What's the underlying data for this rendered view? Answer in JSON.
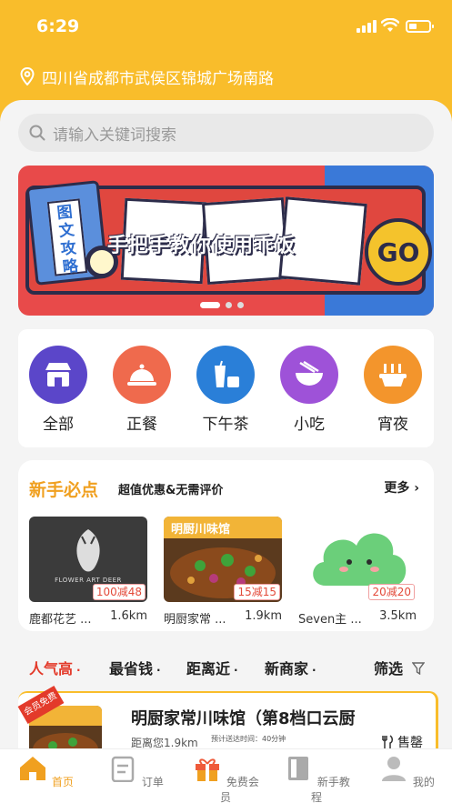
{
  "status": {
    "time": "6:29"
  },
  "location": {
    "address": "四川省成都市武侯区锦城广场南路"
  },
  "search": {
    "placeholder": "请输入关键词搜索"
  },
  "banner": {
    "book_title": "图文攻略",
    "slogan": "手把手教你使用乖饭",
    "go": "GO"
  },
  "categories": [
    {
      "label": "全部",
      "color": "#5b46c9"
    },
    {
      "label": "正餐",
      "color": "#ef6a4d"
    },
    {
      "label": "下午茶",
      "color": "#2a7fd8"
    },
    {
      "label": "小吃",
      "color": "#9e52d8"
    },
    {
      "label": "宵夜",
      "color": "#f3952c"
    }
  ],
  "newbie": {
    "title": "新手必点",
    "subtitle": "超值优惠&无需评价",
    "more": "更多",
    "shops": [
      {
        "name": "鹿都花艺 ...",
        "distance": "1.6km",
        "coupon": "100减48",
        "image_caption": "FLOWER ART DEER"
      },
      {
        "name": "明厨家常 ...",
        "distance": "1.9km",
        "coupon": "15减15",
        "image_caption": "明厨川味馆"
      },
      {
        "name": "Seven主 ...",
        "distance": "3.5km",
        "coupon": "20减20",
        "image_caption": ""
      }
    ]
  },
  "filters": {
    "popular": "人气高",
    "cheapest": "最省钱",
    "nearest": "距离近",
    "new_shops": "新商家",
    "filter": "筛选"
  },
  "shop_card": {
    "tag": "会员免费",
    "name": "明厨家常川味馆（第8档口云厨",
    "distance": "距离您1.9km",
    "stats": "预计送达时间：40分钟",
    "sold_out": "售罄"
  },
  "tabbar": [
    {
      "label": "首页"
    },
    {
      "label": "订单"
    },
    {
      "label": "免费会员"
    },
    {
      "label": "新手教程"
    },
    {
      "label": "我的"
    }
  ],
  "colors": {
    "brand": "#f9bd2b",
    "accent": "#f0a020",
    "red": "#e33a2a"
  }
}
